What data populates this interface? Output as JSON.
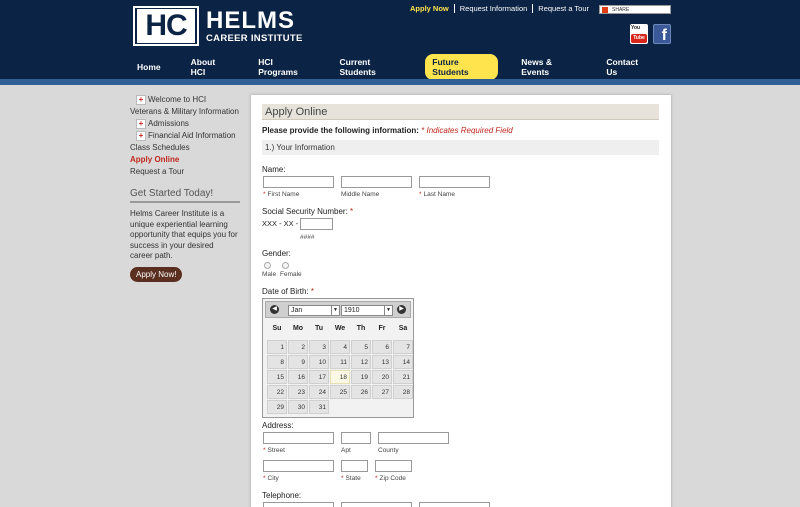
{
  "header": {
    "logo_initials": "HC",
    "logo_name": "HELMS",
    "logo_sub": "CAREER INSTITUTE",
    "toplinks": [
      "Apply Now",
      "Request Information",
      "Request a Tour"
    ],
    "share_label": "SHARE",
    "youtube_label": "You Tube",
    "facebook_label": "f"
  },
  "nav": {
    "items": [
      "Home",
      "About HCI",
      "HCI Programs",
      "Current Students",
      "Future Students",
      "News & Events",
      "Contact Us"
    ],
    "active": "Future Students"
  },
  "sidebar": {
    "items": [
      {
        "label": "Welcome to HCI"
      },
      {
        "label": "Veterans & Military Information"
      },
      {
        "label": "Admissions"
      },
      {
        "label": "Financial Aid Information"
      },
      {
        "label": "Class Schedules"
      },
      {
        "label": "Apply Online"
      },
      {
        "label": "Request a Tour"
      }
    ],
    "get_started_title": "Get Started Today!",
    "get_started_text": "Helms Career Institute is a unique experiential learning opportunity that equips you for success in your desired career path.",
    "apply_button": "Apply Now!"
  },
  "form": {
    "title": "Apply Online",
    "intro": "Please provide the following information:",
    "required_note": "* Indicates Required Field",
    "section1": "1.) Your Information",
    "name_label": "Name:",
    "first_name": "First Name",
    "middle_name": "Middle Name",
    "last_name": "Last Name",
    "ssn_label": "Social Security Number:",
    "ssn_prefix": "XXX - XX -",
    "ssn_hint": "####",
    "gender_label": "Gender:",
    "gender_male": "Male",
    "gender_female": "Female",
    "dob_label": "Date of Birth:",
    "address_label": "Address:",
    "street": "Street",
    "apt": "Apt",
    "county": "County",
    "city": "City",
    "state": "State",
    "zip": "Zip Code",
    "telephone_label": "Telephone:",
    "asterisk": "*"
  },
  "calendar": {
    "prev_icon": "◀",
    "next_icon": "▶",
    "month": "Jan",
    "year": "1910",
    "weekdays": [
      "Su",
      "Mo",
      "Tu",
      "We",
      "Th",
      "Fr",
      "Sa"
    ],
    "days": [
      [
        "1",
        "2",
        "3",
        "4",
        "5",
        "6",
        "7"
      ],
      [
        "8",
        "9",
        "10",
        "11",
        "12",
        "13",
        "14"
      ],
      [
        "15",
        "16",
        "17",
        "18",
        "19",
        "20",
        "21"
      ],
      [
        "22",
        "23",
        "24",
        "25",
        "26",
        "27",
        "28"
      ],
      [
        "29",
        "30",
        "31"
      ]
    ],
    "highlighted_day": "18"
  }
}
